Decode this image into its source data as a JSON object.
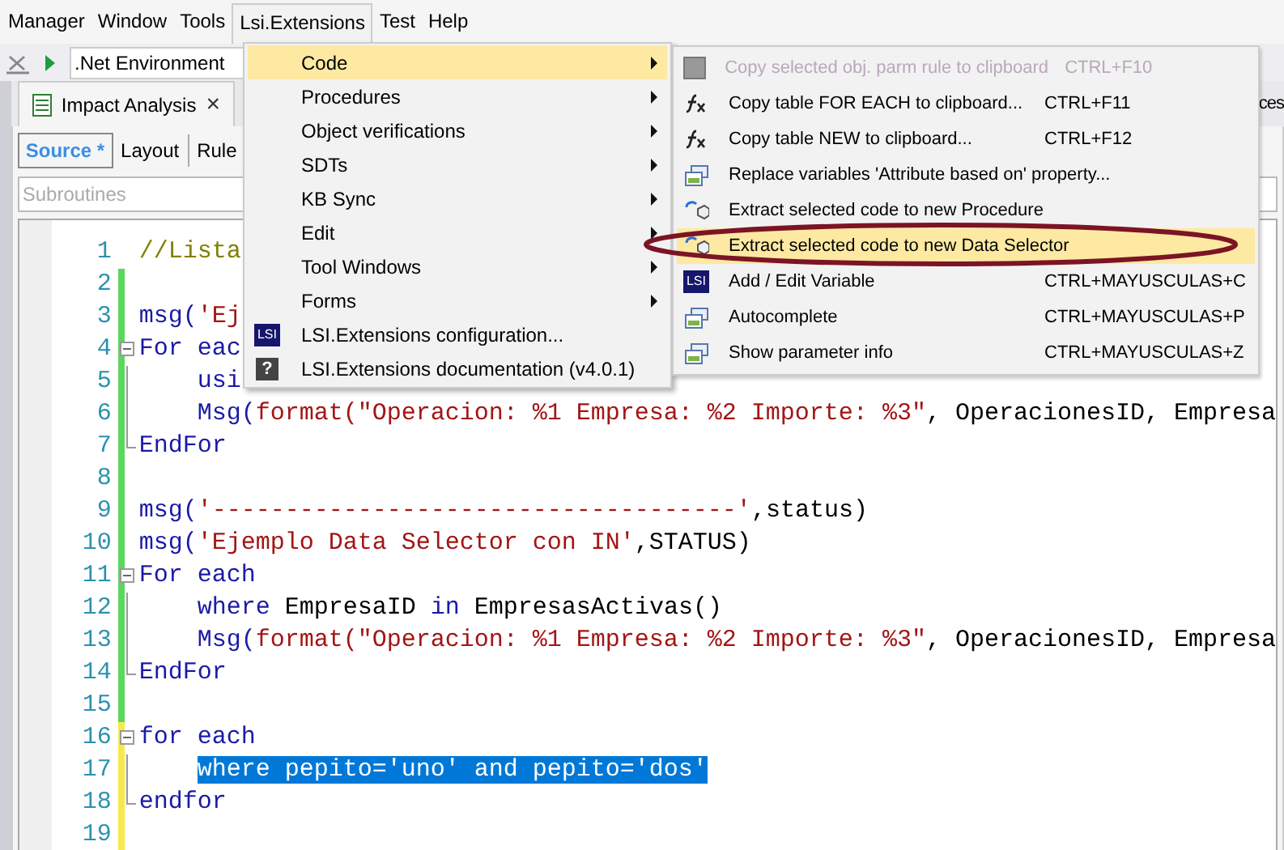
{
  "menu_bar": [
    {
      "label": "Manager",
      "selected": false
    },
    {
      "label": "Window",
      "selected": false
    },
    {
      "label": "Tools",
      "selected": false
    },
    {
      "label": "Lsi.Extensions",
      "selected": true
    },
    {
      "label": "Test",
      "selected": false
    },
    {
      "label": "Help",
      "selected": false
    }
  ],
  "toolbar": {
    "environment": ".Net Environment"
  },
  "document_tab": {
    "label": "Impact Analysis",
    "close": "×"
  },
  "partial_tab": "ces",
  "view_tabs": [
    {
      "label": "Source *",
      "selected": true
    },
    {
      "label": "Layout",
      "selected": false
    },
    {
      "label": "Rule",
      "selected": false
    }
  ],
  "subroutines": {
    "placeholder": "Subroutines"
  },
  "code_lines": [
    {
      "number": "1",
      "changed": false,
      "collapsible": false,
      "in_block": false,
      "block_end": false,
      "selected": false,
      "tokens": [
        {
          "text": "//Lista",
          "kind": "comment"
        }
      ]
    },
    {
      "number": "2",
      "changed": true,
      "saved": true,
      "collapsible": false,
      "in_block": false,
      "block_end": false
    },
    {
      "number": "3",
      "changed": true,
      "saved": true,
      "collapsible": false,
      "in_block": false,
      "block_end": false,
      "selected": false,
      "tokens": [
        {
          "text": "msg(",
          "kind": "keyword"
        },
        {
          "text": "'Ej",
          "kind": "string"
        }
      ]
    },
    {
      "number": "4",
      "changed": true,
      "saved": true,
      "collapsible": true,
      "in_block": false,
      "block_end": false,
      "selected": false,
      "tokens": [
        {
          "text": "For eac",
          "kind": "keyword"
        }
      ]
    },
    {
      "number": "5",
      "changed": true,
      "saved": true,
      "collapsible": false,
      "in_block": true,
      "block_end": false,
      "selected": false,
      "tokens": [
        {
          "text": "    usi",
          "kind": "keyword"
        }
      ]
    },
    {
      "number": "6",
      "changed": true,
      "saved": true,
      "collapsible": false,
      "in_block": true,
      "block_end": false,
      "selected": false,
      "tokens": [
        {
          "text": "    Msg(",
          "kind": "keyword"
        },
        {
          "text": "format(\"Operacion: %1 Empresa: %2 Importe: %3\"",
          "kind": "string"
        },
        {
          "text": ", OperacionesID, Empresa",
          "kind": "plain"
        }
      ]
    },
    {
      "number": "7",
      "changed": true,
      "saved": true,
      "collapsible": false,
      "in_block": false,
      "block_end": true,
      "selected": false,
      "tokens": [
        {
          "text": "EndFor",
          "kind": "keyword"
        }
      ]
    },
    {
      "number": "8",
      "changed": true,
      "saved": true,
      "collapsible": false,
      "in_block": false,
      "block_end": false
    },
    {
      "number": "9",
      "changed": true,
      "saved": true,
      "collapsible": false,
      "in_block": false,
      "block_end": false,
      "selected": false,
      "tokens": [
        {
          "text": "msg(",
          "kind": "keyword"
        },
        {
          "text": "'------------------------------------'",
          "kind": "string"
        },
        {
          "text": ",status)",
          "kind": "plain"
        }
      ]
    },
    {
      "number": "10",
      "changed": true,
      "saved": true,
      "collapsible": false,
      "in_block": false,
      "block_end": false,
      "selected": false,
      "tokens": [
        {
          "text": "msg(",
          "kind": "keyword"
        },
        {
          "text": "'Ejemplo Data Selector con IN'",
          "kind": "string"
        },
        {
          "text": ",STATUS)",
          "kind": "plain"
        }
      ]
    },
    {
      "number": "11",
      "changed": true,
      "saved": true,
      "collapsible": true,
      "in_block": false,
      "block_end": false,
      "selected": false,
      "tokens": [
        {
          "text": "For each",
          "kind": "keyword"
        }
      ]
    },
    {
      "number": "12",
      "changed": true,
      "saved": true,
      "collapsible": false,
      "in_block": true,
      "block_end": false,
      "selected": false,
      "tokens": [
        {
          "text": "    where",
          "kind": "keyword"
        },
        {
          "text": " EmpresaID ",
          "kind": "plain"
        },
        {
          "text": "in",
          "kind": "keyword"
        },
        {
          "text": " EmpresasActivas()",
          "kind": "plain"
        }
      ]
    },
    {
      "number": "13",
      "changed": true,
      "saved": true,
      "collapsible": false,
      "in_block": true,
      "block_end": false,
      "selected": false,
      "tokens": [
        {
          "text": "    Msg(",
          "kind": "keyword"
        },
        {
          "text": "format(\"Operacion: %1 Empresa: %2 Importe: %3\"",
          "kind": "string"
        },
        {
          "text": ", OperacionesID, Empresa",
          "kind": "plain"
        }
      ]
    },
    {
      "number": "14",
      "changed": true,
      "saved": true,
      "collapsible": false,
      "in_block": false,
      "block_end": true,
      "selected": false,
      "tokens": [
        {
          "text": "EndFor",
          "kind": "keyword"
        }
      ]
    },
    {
      "number": "15",
      "changed": true,
      "saved": true,
      "collapsible": false,
      "in_block": false,
      "block_end": false
    },
    {
      "number": "16",
      "changed": true,
      "saved": false,
      "collapsible": true,
      "in_block": false,
      "block_end": false,
      "selected": false,
      "tokens": [
        {
          "text": "for each",
          "kind": "keyword"
        }
      ]
    },
    {
      "number": "17",
      "changed": true,
      "saved": false,
      "collapsible": false,
      "in_block": true,
      "block_end": false,
      "selected": true,
      "tokens": [
        {
          "text": "where pepito='uno' and pepito='dos'",
          "kind": "keyword"
        }
      ]
    },
    {
      "number": "18",
      "changed": true,
      "saved": false,
      "collapsible": false,
      "in_block": false,
      "block_end": true,
      "selected": false,
      "tokens": [
        {
          "text": "endfor",
          "kind": "keyword"
        }
      ]
    },
    {
      "number": "19",
      "changed": true,
      "saved": false,
      "collapsible": false,
      "in_block": false,
      "block_end": false
    }
  ],
  "menu": [
    {
      "label": "Code",
      "kind": "submenu",
      "highlighted": true
    },
    {
      "label": "Procedures",
      "kind": "submenu",
      "highlighted": false
    },
    {
      "label": "Object verifications",
      "kind": "submenu",
      "highlighted": false
    },
    {
      "label": "SDTs",
      "kind": "submenu",
      "highlighted": false
    },
    {
      "label": "KB Sync",
      "kind": "submenu",
      "highlighted": false
    },
    {
      "label": "Edit",
      "kind": "submenu",
      "highlighted": false
    },
    {
      "label": "Tool Windows",
      "kind": "submenu",
      "highlighted": false
    },
    {
      "label": "Forms",
      "kind": "submenu",
      "highlighted": false
    },
    {
      "label": "LSI.Extensions configuration...",
      "kind": "lsi",
      "icon_text": "LSI",
      "highlighted": false
    },
    {
      "label": "LSI.Extensions documentation (v4.0.1)",
      "kind": "help",
      "icon_text": "?",
      "highlighted": false
    }
  ],
  "submenu": [
    {
      "label": "Copy selected obj. parm rule to clipboard",
      "shortcut": "CTRL+F10",
      "kind": "copy",
      "disabled": true,
      "highlighted": false
    },
    {
      "label": "Copy table FOR EACH to clipboard...",
      "shortcut": "CTRL+F11",
      "kind": "fx",
      "disabled": false,
      "highlighted": false
    },
    {
      "label": "Copy table NEW to clipboard...",
      "shortcut": "CTRL+F12",
      "kind": "fx",
      "disabled": false,
      "highlighted": false
    },
    {
      "label": "Replace variables 'Attribute based on' property...",
      "kind": "window",
      "disabled": false,
      "highlighted": false
    },
    {
      "label": "Extract selected code to new Procedure",
      "kind": "extract",
      "disabled": false,
      "highlighted": false
    },
    {
      "label": "Extract selected code to new Data Selector",
      "kind": "extract",
      "disabled": false,
      "highlighted": true
    },
    {
      "label": "Add / Edit Variable",
      "shortcut": "CTRL+MAYUSCULAS+C",
      "kind": "lsi",
      "icon_text": "LSI",
      "disabled": false,
      "highlighted": false
    },
    {
      "label": "Autocomplete",
      "shortcut": "CTRL+MAYUSCULAS+P",
      "kind": "window",
      "disabled": false,
      "highlighted": false
    },
    {
      "label": "Show parameter info",
      "shortcut": "CTRL+MAYUSCULAS+Z",
      "kind": "window",
      "disabled": false,
      "highlighted": false
    }
  ]
}
